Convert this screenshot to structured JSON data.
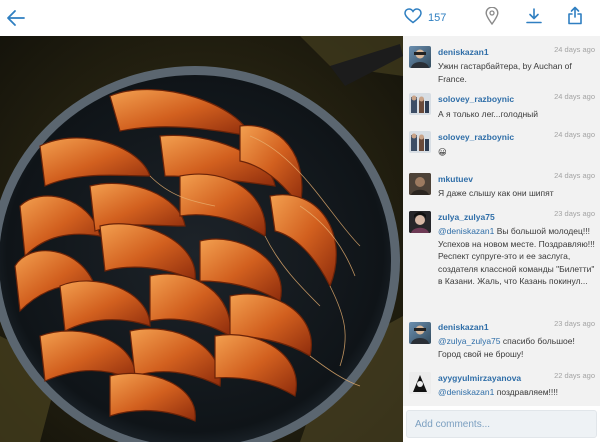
{
  "toolbar": {
    "likes": "157"
  },
  "comments": [
    {
      "user": "deniskazan1",
      "time": "24 days ago",
      "text": "Ужин гастарбайтера, by Auchan of France."
    },
    {
      "user": "solovey_razboynic",
      "time": "24 days ago",
      "text": "А я только лег...голодный"
    },
    {
      "user": "solovey_razboynic",
      "time": "24 days ago",
      "text": "😀"
    },
    {
      "user": "mkutuev",
      "time": "24 days ago",
      "text": "Я даже слышу как они шипят"
    },
    {
      "user": "zulya_zulya75",
      "time": "23 days ago",
      "mention": "@deniskazan1",
      "text": " Вы большой молодец!!! Успехов на новом месте. Поздравляю!!! Респект супруге-это и ее заслуга, создателя классной команды \"Билетти\" в Казани. Жаль, что Казань покинул..."
    },
    {
      "user": "deniskazan1",
      "time": "23 days ago",
      "mention": "@zulya_zulya75",
      "text": " спасибо большое! Город свой не брошу!"
    },
    {
      "user": "ayygyulmirzayanova",
      "time": "22 days ago",
      "mention": "@deniskazan1",
      "text": " поздравляем!!!!"
    }
  ],
  "add_comment": {
    "placeholder": "Add comments..."
  },
  "colors": {
    "link": "#2f6ea8",
    "accent": "#2f7fc1",
    "panel": "#f2f2f2"
  }
}
